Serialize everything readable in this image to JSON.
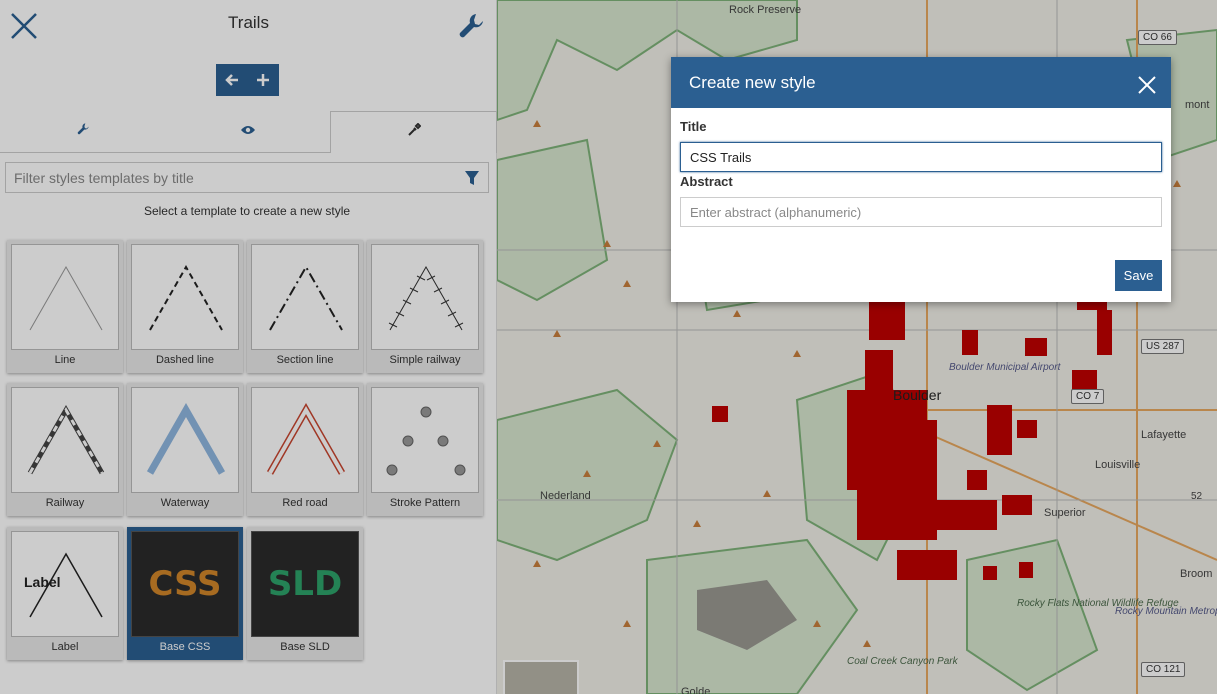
{
  "panel": {
    "title": "Trails",
    "filter_placeholder": "Filter styles templates by title",
    "hint": "Select a template to create a new style",
    "templates": [
      {
        "label": "Line"
      },
      {
        "label": "Dashed line"
      },
      {
        "label": "Section line"
      },
      {
        "label": "Simple railway"
      },
      {
        "label": "Railway"
      },
      {
        "label": "Waterway"
      },
      {
        "label": "Red road"
      },
      {
        "label": "Stroke Pattern"
      },
      {
        "label": "Label",
        "thumb_text": "Label"
      },
      {
        "label": "Base CSS",
        "thumb_text": "CSS",
        "selected": true
      },
      {
        "label": "Base SLD",
        "thumb_text": "SLD"
      }
    ]
  },
  "dialog": {
    "title": "Create new style",
    "title_label": "Title",
    "title_value": "CSS Trails",
    "abstract_label": "Abstract",
    "abstract_placeholder": "Enter abstract (alphanumeric)",
    "save_label": "Save"
  },
  "map": {
    "places": {
      "rock_preserve": "Rock Preserve",
      "boulder": "Boulder",
      "nederland": "Nederland",
      "louisville": "Louisville",
      "superior": "Superior",
      "lafayette": "Lafayette",
      "broomfield": "Broom",
      "mont": "mont",
      "boulder_airport": "Boulder Municipal Airport",
      "rocky_flats": "Rocky Flats National Wildlife Refuge",
      "rocky_mountain_airport": "Rocky Mountain Metropolitan Airport",
      "coal_creek": "Coal Creek Canyon Park",
      "golden": "Golde"
    },
    "shields": {
      "co66": "CO 66",
      "us287": "US 287",
      "co7": "CO 7",
      "co121": "CO 121",
      "r52": "52"
    }
  },
  "colors": {
    "accent": "#2b5f91",
    "css_thumb": "#d1862a",
    "sld_thumb": "#2ea36b",
    "trail_red": "#c00000"
  }
}
